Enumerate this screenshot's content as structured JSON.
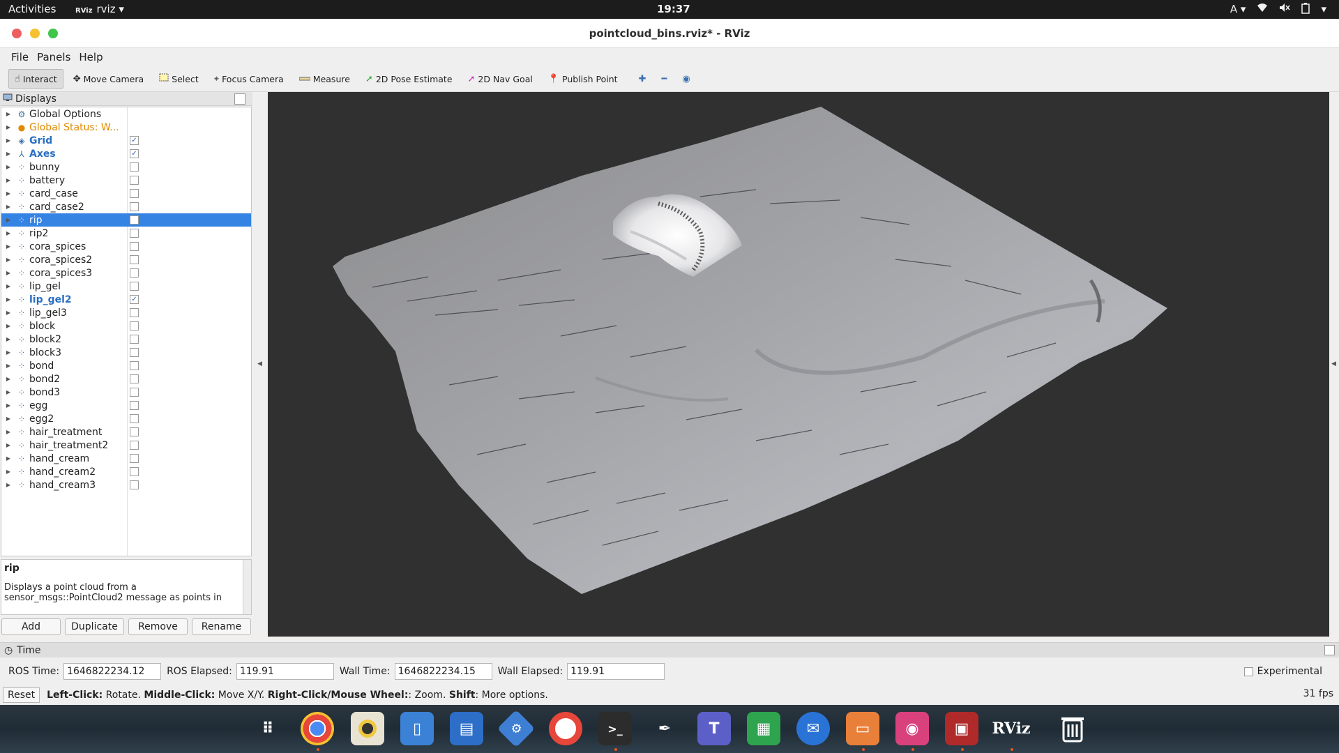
{
  "topbar": {
    "activities": "Activities",
    "app_name": "rviz",
    "app_icon": "RViz",
    "clock": "19:37",
    "keyboard": "A",
    "icons": [
      "wifi-icon",
      "volume-muted-icon",
      "battery-icon",
      "chevron-down-icon"
    ]
  },
  "window": {
    "title": "pointcloud_bins.rviz* - RViz",
    "close_color": "#ed5f5f",
    "minimize_color": "#f5c12e",
    "maximize_color": "#3fc54a"
  },
  "menubar": {
    "file": "File",
    "panels": "Panels",
    "help": "Help"
  },
  "toolbar": {
    "interact": "Interact",
    "move_camera": "Move Camera",
    "select": "Select",
    "focus_camera": "Focus Camera",
    "measure": "Measure",
    "pose_estimate": "2D Pose Estimate",
    "nav_goal": "2D Nav Goal",
    "publish_point": "Publish Point"
  },
  "displays": {
    "title": "Displays",
    "items": [
      {
        "label": "Global Options",
        "checked": null,
        "style": "plain",
        "icon": "gear-icon"
      },
      {
        "label": "Global Status: W...",
        "checked": null,
        "style": "warn",
        "icon": "warning-icon"
      },
      {
        "label": "Grid",
        "checked": true,
        "style": "bold",
        "icon": "grid-icon"
      },
      {
        "label": "Axes",
        "checked": true,
        "style": "bold",
        "icon": "axes-icon"
      },
      {
        "label": "bunny",
        "checked": false,
        "style": "plain",
        "icon": "pointcloud-icon"
      },
      {
        "label": "battery",
        "checked": false,
        "style": "plain",
        "icon": "pointcloud-icon"
      },
      {
        "label": "card_case",
        "checked": false,
        "style": "plain",
        "icon": "pointcloud-icon"
      },
      {
        "label": "card_case2",
        "checked": false,
        "style": "plain",
        "icon": "pointcloud-icon"
      },
      {
        "label": "rip",
        "checked": false,
        "style": "selected",
        "icon": "pointcloud-icon"
      },
      {
        "label": "rip2",
        "checked": false,
        "style": "plain",
        "icon": "pointcloud-icon"
      },
      {
        "label": "cora_spices",
        "checked": false,
        "style": "plain",
        "icon": "pointcloud-icon"
      },
      {
        "label": "cora_spices2",
        "checked": false,
        "style": "plain",
        "icon": "pointcloud-icon"
      },
      {
        "label": "cora_spices3",
        "checked": false,
        "style": "plain",
        "icon": "pointcloud-icon"
      },
      {
        "label": "lip_gel",
        "checked": false,
        "style": "plain",
        "icon": "pointcloud-icon"
      },
      {
        "label": "lip_gel2",
        "checked": true,
        "style": "bold",
        "icon": "pointcloud-icon"
      },
      {
        "label": "lip_gel3",
        "checked": false,
        "style": "plain",
        "icon": "pointcloud-icon"
      },
      {
        "label": "block",
        "checked": false,
        "style": "plain",
        "icon": "pointcloud-icon"
      },
      {
        "label": "block2",
        "checked": false,
        "style": "plain",
        "icon": "pointcloud-icon"
      },
      {
        "label": "block3",
        "checked": false,
        "style": "plain",
        "icon": "pointcloud-icon"
      },
      {
        "label": "bond",
        "checked": false,
        "style": "plain",
        "icon": "pointcloud-icon"
      },
      {
        "label": "bond2",
        "checked": false,
        "style": "plain",
        "icon": "pointcloud-icon"
      },
      {
        "label": "bond3",
        "checked": false,
        "style": "plain",
        "icon": "pointcloud-icon"
      },
      {
        "label": "egg",
        "checked": false,
        "style": "plain",
        "icon": "pointcloud-icon"
      },
      {
        "label": "egg2",
        "checked": false,
        "style": "plain",
        "icon": "pointcloud-icon"
      },
      {
        "label": "hair_treatment",
        "checked": false,
        "style": "plain",
        "icon": "pointcloud-icon"
      },
      {
        "label": "hair_treatment2",
        "checked": false,
        "style": "plain",
        "icon": "pointcloud-icon"
      },
      {
        "label": "hand_cream",
        "checked": false,
        "style": "plain",
        "icon": "pointcloud-icon"
      },
      {
        "label": "hand_cream2",
        "checked": false,
        "style": "plain",
        "icon": "pointcloud-icon"
      },
      {
        "label": "hand_cream3",
        "checked": false,
        "style": "plain",
        "icon": "pointcloud-icon"
      }
    ],
    "description_title": "rip",
    "description_text": "Displays a point cloud from a sensor_msgs::PointCloud2 message as points in",
    "buttons": {
      "add": "Add",
      "duplicate": "Duplicate",
      "remove": "Remove",
      "rename": "Rename"
    }
  },
  "time": {
    "title": "Time",
    "ros_time_label": "ROS Time:",
    "ros_time": "1646822234.12",
    "ros_elapsed_label": "ROS Elapsed:",
    "ros_elapsed": "119.91",
    "wall_time_label": "Wall Time:",
    "wall_time": "1646822234.15",
    "wall_elapsed_label": "Wall Elapsed:",
    "wall_elapsed": "119.91",
    "experimental": "Experimental"
  },
  "status": {
    "reset": "Reset",
    "left_click": "Left-Click:",
    "left_click_action": " Rotate. ",
    "middle_click": "Middle-Click:",
    "middle_click_action": " Move X/Y. ",
    "right_click": "Right-Click/Mouse Wheel:",
    "right_click_action": ": Zoom. ",
    "shift": "Shift",
    "shift_action": ": More options.",
    "fps": "31 fps"
  },
  "dock": {
    "apps": [
      "apps-grid-icon",
      "chrome-icon",
      "rhythmbox-icon",
      "files-icon",
      "writer-icon",
      "settings-icon",
      "help-icon",
      "terminal-icon",
      "inkscape-icon",
      "teams-icon",
      "calc-icon",
      "thunderbird-icon",
      "impress-icon",
      "image-viewer-icon",
      "rqt-icon",
      "rviz-icon",
      "trash-icon"
    ],
    "rviz_label": "RViz"
  }
}
